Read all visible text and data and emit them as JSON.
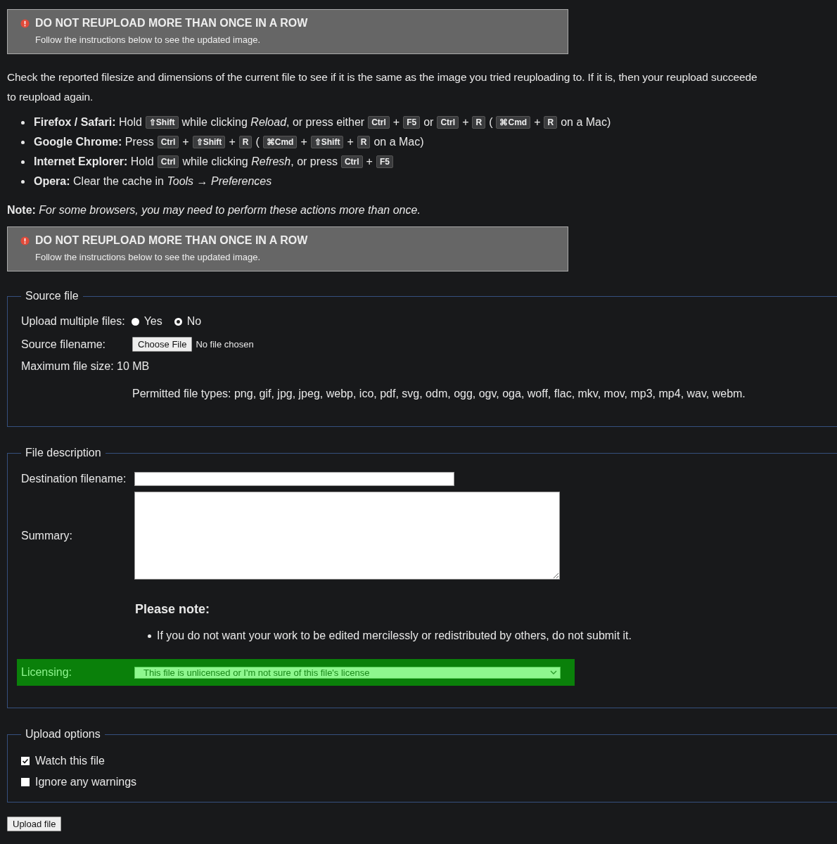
{
  "top_alert": {
    "title": "DO NOT REUPLOAD MORE THAN ONCE IN A ROW",
    "text": "Follow the instructions below to see the updated image."
  },
  "intro": {
    "line_1": "Check the reported filesize and dimensions of the current file to see if it is the same as the image you tried reuploading to. If it is, then your reupload succeede",
    "line_2": "to reupload again."
  },
  "instructions": [
    {
      "segments": [
        {
          "kind": "text",
          "text": "**Firefox / Safari:** Hold"
        },
        {
          "kind": "key",
          "text": "⇧Shift"
        },
        {
          "kind": "text",
          "text": "while clicking *Reload*, or press either"
        },
        {
          "kind": "key",
          "text": "Ctrl"
        },
        {
          "kind": "text",
          "text": "+"
        },
        {
          "kind": "key",
          "text": "F5"
        },
        {
          "kind": "text",
          "text": "or"
        },
        {
          "kind": "key",
          "text": "Ctrl"
        },
        {
          "kind": "text",
          "text": "+"
        },
        {
          "kind": "key",
          "text": "R"
        },
        {
          "kind": "text",
          "text": "("
        },
        {
          "kind": "key",
          "text": "⌘Cmd"
        },
        {
          "kind": "text",
          "text": "+"
        },
        {
          "kind": "key",
          "text": "R"
        },
        {
          "kind": "text",
          "text": "on a Mac)"
        }
      ]
    },
    {
      "segments": [
        {
          "kind": "text",
          "text": "**Google Chrome:** Press"
        },
        {
          "kind": "key",
          "text": "Ctrl"
        },
        {
          "kind": "text",
          "text": "+"
        },
        {
          "kind": "key",
          "text": "⇧Shift"
        },
        {
          "kind": "text",
          "text": "+"
        },
        {
          "kind": "key",
          "text": "R"
        },
        {
          "kind": "text",
          "text": "("
        },
        {
          "kind": "key",
          "text": "⌘Cmd"
        },
        {
          "kind": "text",
          "text": "+"
        },
        {
          "kind": "key",
          "text": "⇧Shift"
        },
        {
          "kind": "text",
          "text": "+"
        },
        {
          "kind": "key",
          "text": "R"
        },
        {
          "kind": "text",
          "text": "on a Mac)"
        }
      ]
    },
    {
      "segments": [
        {
          "kind": "text",
          "text": "**Internet Explorer:** Hold"
        },
        {
          "kind": "key",
          "text": "Ctrl"
        },
        {
          "kind": "text",
          "text": "while clicking *Refresh*, or press"
        },
        {
          "kind": "key",
          "text": "Ctrl"
        },
        {
          "kind": "text",
          "text": "+"
        },
        {
          "kind": "key",
          "text": "F5"
        }
      ]
    },
    {
      "segments": [
        {
          "kind": "text",
          "text": "**Opera:** Clear the cache in *Tools* → *Preferences*"
        }
      ]
    }
  ],
  "note": "**Note:** *For some browsers, you may need to perform these actions more than once.*",
  "bottom_alert": {
    "title": "DO NOT REUPLOAD MORE THAN ONCE IN A ROW",
    "text": "Follow the instructions below to see the updated image."
  },
  "source_file": {
    "legend": "Source file",
    "multiple_label": "Upload multiple files:",
    "options": [
      {
        "label": "Yes",
        "selected": false
      },
      {
        "label": "No",
        "selected": true
      }
    ],
    "filename_label": "Source filename:",
    "choose_button": "Choose File",
    "no_file_text": "No file chosen",
    "max_size": "Maximum file size: 10 MB",
    "permitted": "Permitted file types: png, gif, jpg, jpeg, webp, ico, pdf, svg, odm, ogg, ogv, oga, woff, flac, mkv, mov, mp3, mp4, wav, webm."
  },
  "file_description": {
    "legend": "File description",
    "destination_label": "Destination filename:",
    "summary_label": "Summary:",
    "note_heading": "Please note:",
    "note_items": [
      "If you do not want your work to be edited mercilessly or redistributed by others, do not submit it."
    ],
    "licensing_label": "Licensing:",
    "licensing_value": "This file is unlicensed or I'm not sure of this file's license"
  },
  "upload_options": {
    "legend": "Upload options",
    "options": [
      {
        "label": "Watch this file",
        "checked": true
      },
      {
        "label": "Ignore any warnings",
        "checked": false
      }
    ]
  },
  "submit_button": "Upload file"
}
